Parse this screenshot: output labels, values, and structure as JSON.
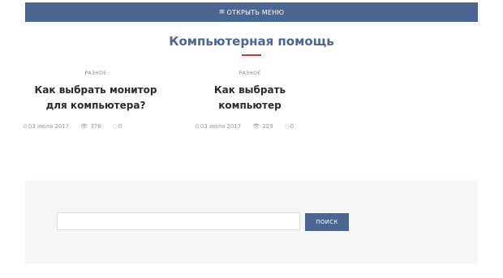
{
  "menu": {
    "icon": "hamburger-icon",
    "label": "ОТКРЫТЬ МЕНЮ"
  },
  "section": {
    "title": "Компьютерная помощь",
    "accent": "#d9342b",
    "brand": "#4a6691"
  },
  "posts": [
    {
      "category": "РАЗНОЕ",
      "title_line1": "Как выбрать монитор",
      "title_line2": "для компьютера?",
      "date": "03 июля 2017",
      "views": "378",
      "comments": "0"
    },
    {
      "category": "РАЗНОЕ",
      "title_line1": "Как выбрать",
      "title_line2": "компьютер",
      "date": "03 июля 2017",
      "views": "229",
      "comments": "0"
    }
  ],
  "search": {
    "value": "",
    "placeholder": "",
    "button_label": "ПОИСК"
  }
}
